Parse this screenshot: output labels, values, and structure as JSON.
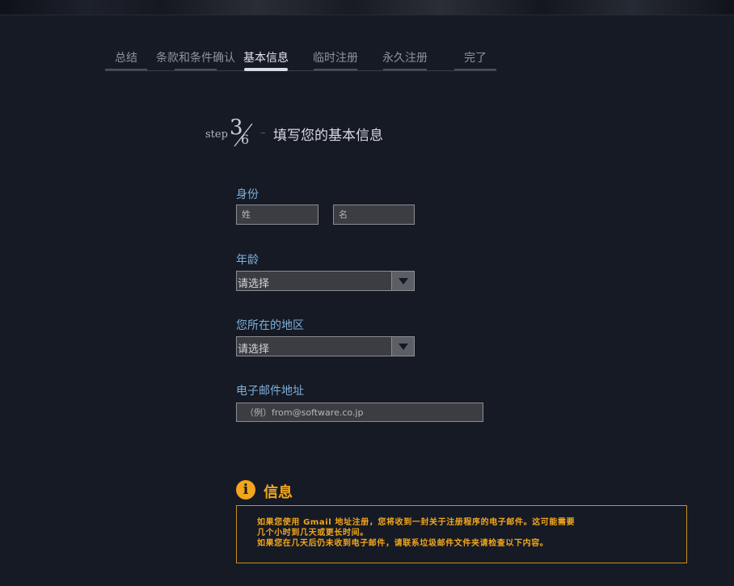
{
  "tabs": [
    {
      "label": "总结"
    },
    {
      "label": "条款和条件确认"
    },
    {
      "label": "基本信息"
    },
    {
      "label": "临时注册"
    },
    {
      "label": "永久注册"
    },
    {
      "label": "完了"
    }
  ],
  "step": {
    "word": "step",
    "current": "3",
    "total": "6",
    "dash": "–",
    "title": "填写您的基本信息"
  },
  "form": {
    "identity": {
      "label": "身份",
      "last_name_placeholder": "姓",
      "first_name_placeholder": "名"
    },
    "age": {
      "label": "年龄",
      "selected": "请选择"
    },
    "region": {
      "label": "您所在的地区",
      "selected": "请选择"
    },
    "email": {
      "label": "电子邮件地址",
      "placeholder": "（例）from@software.co.jp"
    }
  },
  "info": {
    "icon": "info-icon",
    "icon_glyph": "i",
    "title": "信息",
    "lines": [
      "如果您使用 Gmail 地址注册，您将收到一封关于注册程序的电子邮件。这可能需要",
      "几个小时到几天或更长时间。",
      "如果您在几天后仍未收到电子邮件，请联系垃圾邮件文件夹请检查以下内容。"
    ]
  },
  "colors": {
    "background": "#161a24",
    "label_blue": "#7fb0dc",
    "info_orange": "#f2a61c"
  }
}
